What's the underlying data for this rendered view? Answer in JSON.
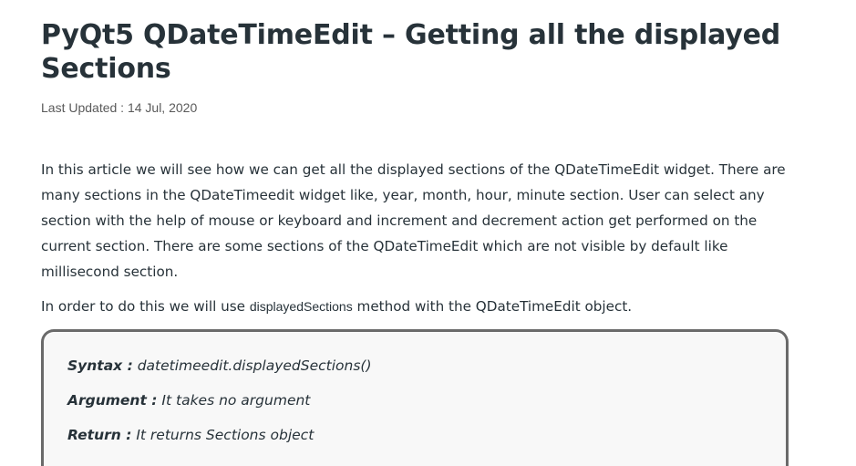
{
  "article": {
    "title": "PyQt5 QDateTimeEdit – Getting all the displayed Sections",
    "last_updated_label": "Last Updated : ",
    "last_updated_date": "14 Jul, 2020",
    "paragraph1": "In this article we will see how we can get all the displayed sections of the QDateTimeEdit widget. There are many sections in the QDateTimeedit widget like, year, month, hour, minute section. User can select any section with the help of mouse or keyboard and increment and decrement action get performed on the current section. There are some sections of the QDateTimeEdit which are not visible by default like millisecond section.",
    "paragraph2_before": "In order to do this we will use ",
    "paragraph2_code": "displayedSections",
    "paragraph2_after": " method with the QDateTimeEdit object."
  },
  "syntax_box": {
    "syntax_key": "Syntax :",
    "syntax_value": " datetimeedit.displayedSections()",
    "argument_key": "Argument :",
    "argument_value": " It takes no argument",
    "return_key": "Return :",
    "return_value": " It returns Sections object"
  }
}
